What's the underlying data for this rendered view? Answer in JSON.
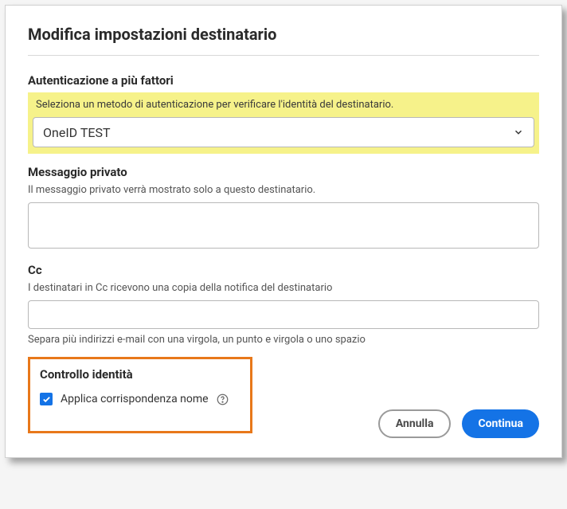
{
  "title": "Modifica impostazioni destinatario",
  "auth": {
    "heading": "Autenticazione a più fattori",
    "helper": "Seleziona un metodo di autenticazione per verificare l'identità del destinatario.",
    "selected": "OneID TEST"
  },
  "privateMessage": {
    "heading": "Messaggio privato",
    "helper": "Il messaggio privato verrà mostrato solo a questo destinatario.",
    "value": ""
  },
  "cc": {
    "heading": "Cc",
    "helper": "I destinatari in Cc ricevono una copia della notifica del destinatario",
    "value": "",
    "separatorNote": "Separa più indirizzi e-mail con una virgola, un punto e virgola o uno spazio"
  },
  "identity": {
    "heading": "Controllo identità",
    "checkboxLabel": "Applica corrispondenza nome",
    "checked": true
  },
  "buttons": {
    "cancel": "Annulla",
    "continue": "Continua"
  }
}
